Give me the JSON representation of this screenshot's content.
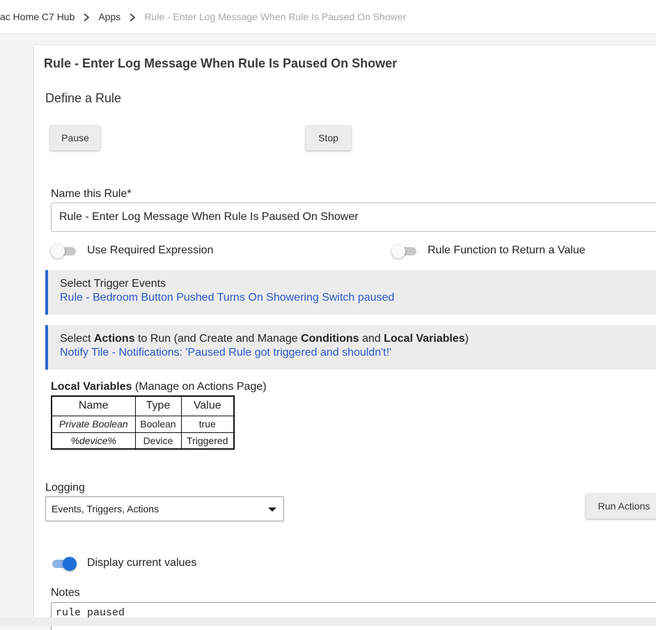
{
  "breadcrumb": {
    "items": [
      {
        "label": "ac Home C7 Hub"
      },
      {
        "label": "Apps"
      },
      {
        "label": "Rule - Enter Log Message When Rule Is Paused On Shower"
      }
    ]
  },
  "app": {
    "title": "Rule - Enter Log Message When Rule Is Paused On Shower",
    "section_title": "Define a Rule",
    "pause_label": "Pause",
    "stop_label": "Stop"
  },
  "name_field": {
    "label": "Name this Rule*",
    "value": "Rule - Enter Log Message When Rule Is Paused On Shower"
  },
  "toggles": {
    "required_expression": {
      "label": "Use Required Expression",
      "on": false
    },
    "rule_function": {
      "label": "Rule Function to Return a Value",
      "on": false
    },
    "display_values": {
      "label": "Display current values",
      "on": true
    }
  },
  "trigger_panel": {
    "title": "Select Trigger Events",
    "value": "Rule - Bedroom Button Pushed Turns On Showering Switch paused"
  },
  "actions_panel": {
    "title_parts": {
      "p1": "Select ",
      "b1": "Actions",
      "p2": " to Run (and Create and Manage ",
      "b2": "Conditions",
      "p3": " and ",
      "b3": "Local Variables",
      "p4": ")"
    },
    "value": "Notify Tile - Notifications: 'Paused Rule got triggered and shouldn't!'"
  },
  "local_variables": {
    "title_bold": "Local Variables",
    "title_rest": " (Manage on Actions Page)",
    "headers": [
      "Name",
      "Type",
      "Value"
    ],
    "rows": [
      [
        "Private Boolean",
        "Boolean",
        "true"
      ],
      [
        "%device%",
        "Device",
        "Triggered"
      ]
    ]
  },
  "logging": {
    "label": "Logging",
    "selected": "Events, Triggers, Actions"
  },
  "run_actions_label": "Run Actions",
  "notes": {
    "label": "Notes",
    "value": "rule paused"
  },
  "colors": {
    "accent": "#2b67d1",
    "link": "#2a57c4",
    "toggle_on": "#1e6fd9"
  }
}
